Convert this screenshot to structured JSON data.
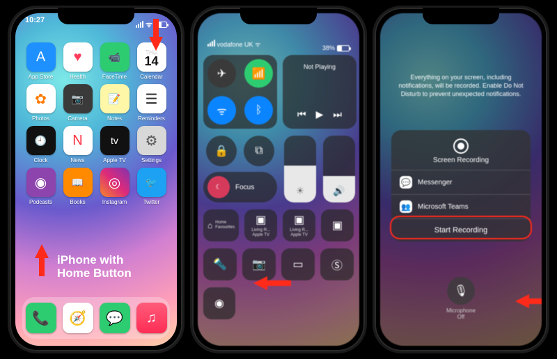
{
  "phone1": {
    "time": "10:27",
    "apps": [
      {
        "label": "App Store",
        "bg": "#1e90ff",
        "glyph": "A"
      },
      {
        "label": "Health",
        "bg": "#ffffff",
        "glyph": "♥",
        "fg": "#ff3b5c"
      },
      {
        "label": "FaceTime",
        "bg": "#2ecc71",
        "glyph": "📹"
      },
      {
        "label": "Calendar",
        "bg": "cal",
        "glyph": "14",
        "top": "THU"
      },
      {
        "label": "Photos",
        "bg": "#ffffff",
        "glyph": "✿",
        "fg": "#ff7a00"
      },
      {
        "label": "Camera",
        "bg": "#3a3a3a",
        "glyph": "📷"
      },
      {
        "label": "Notes",
        "bg": "#fff7a8",
        "glyph": "📝"
      },
      {
        "label": "Reminders",
        "bg": "#ffffff",
        "glyph": "☰",
        "fg": "#333"
      },
      {
        "label": "Clock",
        "bg": "#111111",
        "glyph": "🕘"
      },
      {
        "label": "News",
        "bg": "#ffffff",
        "glyph": "N",
        "fg": "#ff3040"
      },
      {
        "label": "Apple TV",
        "bg": "#111111",
        "glyph": "tv"
      },
      {
        "label": "Settings",
        "bg": "#d8d8d8",
        "glyph": "⚙",
        "fg": "#555"
      },
      {
        "label": "Podcasts",
        "bg": "#8e44ad",
        "glyph": "◉"
      },
      {
        "label": "Books",
        "bg": "#ff8a00",
        "glyph": "📖"
      },
      {
        "label": "Instagram",
        "bg": "linear-gradient(45deg,#f58529,#dd2a7b,#8134af)",
        "glyph": "◎"
      },
      {
        "label": "Twitter",
        "bg": "#1da1f2",
        "glyph": "🐦"
      }
    ],
    "dock": [
      {
        "name": "phone",
        "bg": "#2ecc71",
        "glyph": "📞"
      },
      {
        "name": "safari",
        "bg": "#ffffff",
        "glyph": "🧭"
      },
      {
        "name": "messages",
        "bg": "#2ecc71",
        "glyph": "💬"
      },
      {
        "name": "music",
        "bg": "linear-gradient(180deg,#ff5c7a,#ff2d55)",
        "glyph": "♫"
      }
    ],
    "annot_text1": "iPhone with",
    "annot_text2": "Home Button"
  },
  "phone2": {
    "carrier": "vodafone UK",
    "battery_pct": "38%",
    "battery_fill": 38,
    "media_title": "Not Playing",
    "connectivity": {
      "airplane": {
        "on": false,
        "bg": "#3a3a3a",
        "glyph": "✈"
      },
      "cellular": {
        "on": true,
        "bg": "#2ecc71",
        "glyph": "📶"
      },
      "wifi": {
        "on": true,
        "bg": "#0a84ff",
        "glyph": "ᯤ"
      },
      "bluetooth": {
        "on": true,
        "bg": "#0a84ff",
        "glyph": "ᛒ"
      }
    },
    "focus_label": "Focus",
    "brightness_pct": 55,
    "volume_pct": 40,
    "tiles_row3": [
      {
        "name": "home-tile",
        "glyph": "⌂",
        "line1": "Home",
        "line2": "Favourites"
      },
      {
        "name": "remote-1",
        "glyph": "▣",
        "line1": "Living R...",
        "line2": "Apple TV"
      },
      {
        "name": "remote-2",
        "glyph": "▣",
        "line1": "Living R...",
        "line2": "Apple TV"
      },
      {
        "name": "remote-3",
        "glyph": "▣",
        "line1": "",
        "line2": ""
      }
    ],
    "tiles_row4": [
      {
        "name": "flashlight",
        "glyph": "🔦"
      },
      {
        "name": "camera",
        "glyph": "📷"
      },
      {
        "name": "apple-remote",
        "glyph": "▭"
      },
      {
        "name": "shazam",
        "glyph": "Ⓢ"
      }
    ],
    "record_tile_glyph": "◉"
  },
  "phone3": {
    "info_text": "Everything on your screen, including notifications, will be recorded. Enable Do Not Disturb to prevent unexpected notifications.",
    "sheet_title": "Screen Recording",
    "options": [
      {
        "name": "messenger",
        "label": "Messenger",
        "bg": "#ffffff",
        "glyph": "💬",
        "fg": "#8a3cff"
      },
      {
        "name": "teams",
        "label": "Microsoft Teams",
        "bg": "#ffffff",
        "glyph": "👥",
        "fg": "#5558af"
      }
    ],
    "start_label": "Start Recording",
    "mic_line1": "Microphone",
    "mic_line2": "Off"
  }
}
